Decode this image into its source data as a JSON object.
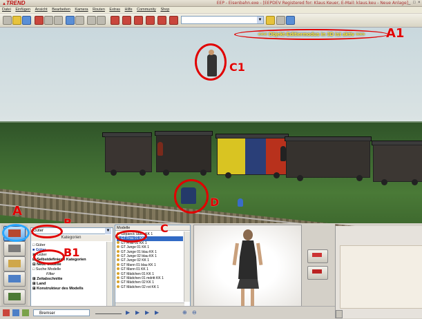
{
  "window": {
    "logo": "TREND",
    "title": "EEP - Eisenbahn.exe - [EEPDEV Registered for: Klaus Keuer, E-Mail: klaus.keu - Neue Anlage]"
  },
  "menu": [
    "Datei",
    "Einfügen",
    "Ansicht",
    "Bearbeiten",
    "Kamera",
    "Routen",
    "Extras",
    "Hilfe",
    "Community",
    "Shop"
  ],
  "scene": {
    "banner": "<<<  Objekt-Editiermodus in 3D ist aktiv  >>>",
    "labels": {
      "a1": "A1",
      "c1": "C1",
      "d": "D",
      "a": "A",
      "b": "B",
      "b1": "B1",
      "c": "C"
    }
  },
  "category": {
    "combo_value": "Güter",
    "header": "Kategorien",
    "tree": [
      "□ Güter",
      "■ Güter",
      "▣ Güter",
      "⊟ Selbstdefinierte Kategorien",
      "⊟ Neue Modelle",
      "  □ Suche Modelle",
      "Filter",
      "⊞ Zeitabschnitte",
      "⊞ Land",
      "⊞ Konstrukteur des Modells"
    ]
  },
  "models": {
    "header": "Modelle",
    "items": [
      "Gepaeck Stack KK 1",
      "GT Frau 01 KK 1",
      "GT Frau 02 KK 1",
      "GT Junge 01 KK 1",
      "GT Junge 01 blau KK 1",
      "GT Junge 02 blau KK 1",
      "GT Junge 02 KK 1",
      "GT Mann 01 blau KK 1",
      "GT Mann 01 KK 1",
      "GT Mädchen 01 KK 1",
      "GT Mädchen 01 mdritt KK 1",
      "GT Mädchen 02 KK 1",
      "GT Mädchen 02 rot KK 1"
    ],
    "selected_index": 1
  },
  "statusbar": {
    "tool_value": "Bremser"
  },
  "icons": {
    "toolbar": [
      "new-icon",
      "open-icon",
      "save-icon",
      "print-icon",
      "undo-icon",
      "redo-icon",
      "train-icon",
      "help-icon"
    ],
    "panel": [
      "track-icon",
      "road-icon",
      "tram-icon",
      "water-icon",
      "landscape-icon"
    ]
  }
}
